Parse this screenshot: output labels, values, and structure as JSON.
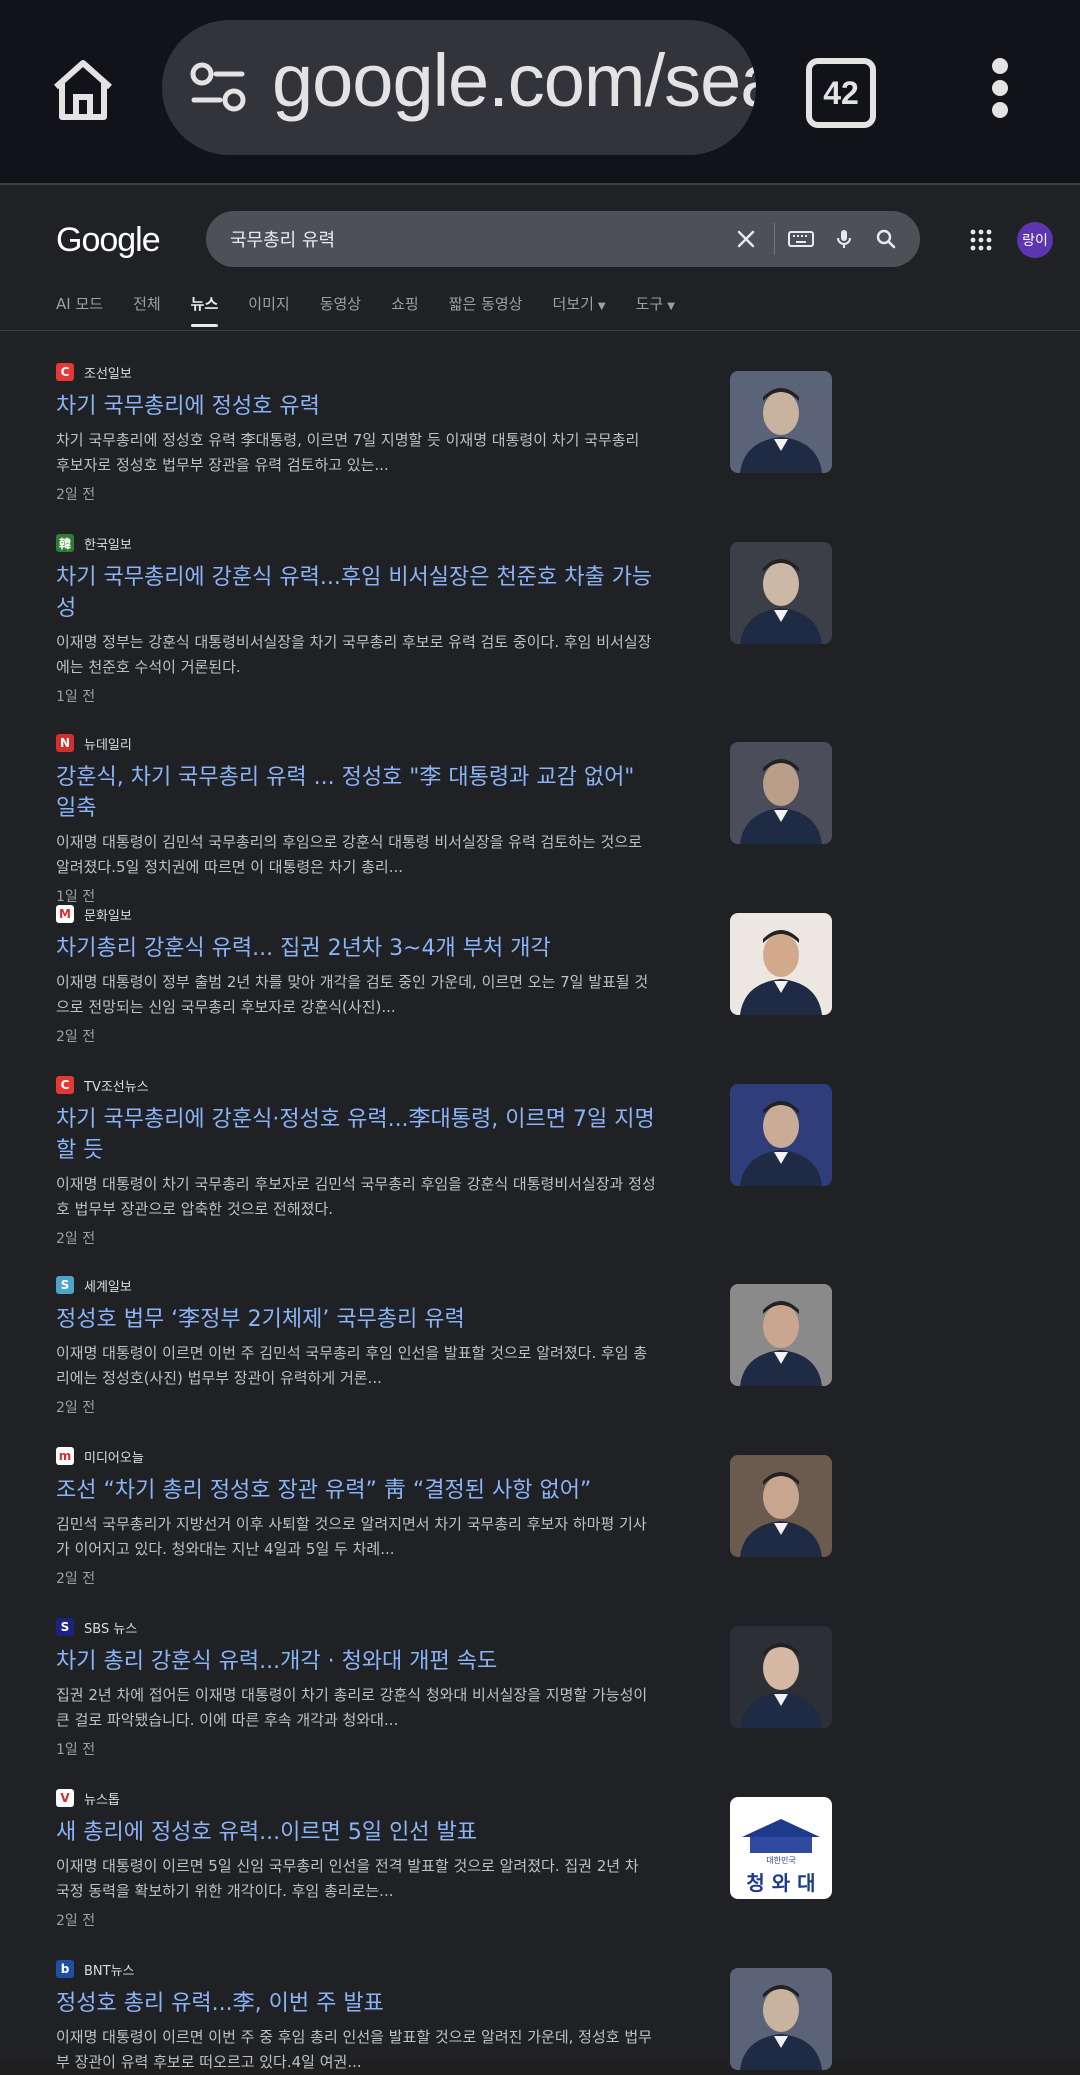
{
  "browser": {
    "url": "google.com/sea",
    "tab_count": "42"
  },
  "google": {
    "logo": "Google",
    "query": "국무총리 유력",
    "avatar": "랑이",
    "nav": [
      {
        "label": "AI 모드"
      },
      {
        "label": "전체"
      },
      {
        "label": "뉴스"
      },
      {
        "label": "이미지"
      },
      {
        "label": "동영상"
      },
      {
        "label": "쇼핑"
      },
      {
        "label": "짧은 동영상"
      },
      {
        "label": "더보기"
      },
      {
        "label": "도구"
      }
    ]
  },
  "results": [
    {
      "source": "조선일보",
      "title": "차기 국무총리에 정성호 유력",
      "snippet": "차기 국무총리에 정성호 유력 李대통령, 이르면 7일 지명할 듯 이재명 대통령이 차기 국무총리 후보자로 정성호 법무부 장관을 유력 검토하고 있는...",
      "time": "2일 전",
      "fav_color": "#e53935",
      "fav_text": "C"
    },
    {
      "source": "한국일보",
      "title": "차기 국무총리에 강훈식 유력...후임 비서실장은 천준호 차출 가능성",
      "snippet": "이재명 정부는 강훈식 대통령비서실장을 차기 국무총리 후보로 유력 검토 중이다. 후임 비서실장에는 천준호 수석이 거론된다.",
      "time": "1일 전",
      "fav_color": "#2e7d32",
      "fav_text": "韓"
    },
    {
      "source": "뉴데일리",
      "title": "강훈식, 차기 국무총리 유력 ... 정성호 \"李 대통령과 교감 없어\" 일축",
      "snippet": "이재명 대통령이 김민석 국무총리의 후임으로 강훈식 대통령 비서실장을 유력 검토하는 것으로 알려졌다.5일 정치권에 따르면 이 대통령은 차기 총리...",
      "time": "1일 전",
      "fav_color": "#d32f2f",
      "fav_text": "N"
    },
    {
      "source": "문화일보",
      "title": "차기총리 강훈식 유력... 집권 2년차 3~4개 부처 개각",
      "snippet": "이재명 대통령이 정부 출범 2년 차를 맞아 개각을 검토 중인 가운데, 이르면 오는 7일 발표될 것으로 전망되는 신임 국무총리 후보자로 강훈식(사진)...",
      "time": "2일 전",
      "fav_color": "#ffffff",
      "fav_text": "M"
    },
    {
      "source": "TV조선뉴스",
      "title": "차기 국무총리에 강훈식·정성호 유력...李대통령, 이르면 7일 지명할 듯",
      "snippet": "이재명 대통령이 차기 국무총리 후보자로 김민석 국무총리 후임을 강훈식 대통령비서실장과 정성호 법무부 장관으로 압축한 것으로 전해졌다.",
      "time": "2일 전",
      "fav_color": "#e53935",
      "fav_text": "C"
    },
    {
      "source": "세계일보",
      "title": "정성호 법무 ‘李정부 2기체제’ 국무총리 유력",
      "snippet": "이재명 대통령이 이르면 이번 주 김민석 국무총리 후임 인선을 발표할 것으로 알려졌다. 후임 총리에는 정성호(사진) 법무부 장관이 유력하게 거론...",
      "time": "2일 전",
      "fav_color": "#4fa3c7",
      "fav_text": "S"
    },
    {
      "source": "미디어오늘",
      "title": "조선 “차기 총리 정성호 장관 유력” 靑 “결정된 사항 없어”",
      "snippet": "김민석 국무총리가 지방선거 이후 사퇴할 것으로 알려지면서 차기 국무총리 후보자 하마평 기사가 이어지고 있다. 청와대는 지난 4일과 5일 두 차례...",
      "time": "2일 전",
      "fav_color": "#ffffff",
      "fav_text": "m"
    },
    {
      "source": "SBS 뉴스",
      "title": "차기 총리 강훈식 유력...개각 · 청와대 개편 속도",
      "snippet": "집권 2년 차에 접어든 이재명 대통령이 차기 총리로 강훈식 청와대 비서실장을 지명할 가능성이 큰 걸로 파악됐습니다. 이에 따른 후속 개각과 청와대...",
      "time": "1일 전",
      "fav_color": "#1a237e",
      "fav_text": "S"
    },
    {
      "source": "뉴스톱",
      "title": "새 총리에 정성호 유력...이르면 5일 인선 발표",
      "snippet": "이재명 대통령이 이르면 5일 신임 국무총리 인선을 전격 발표할 것으로 알려졌다. 집권 2년 차 국정 동력을 확보하기 위한 개각이다. 후임 총리로는...",
      "time": "2일 전",
      "fav_color": "#ffffff",
      "fav_text": "V"
    },
    {
      "source": "BNT뉴스",
      "title": "정성호 총리 유력...李, 이번 주 발표",
      "snippet": "이재명 대통령이 이르면 이번 주 중 후임 총리 인선을 발표할 것으로 알려진 가운데, 정성호 법무부 장관이 유력 후보로 떠오르고 있다.4일 여권...",
      "time": "",
      "fav_color": "#1e4fa1",
      "fav_text": "b"
    }
  ],
  "thumbnail_label": "청 와 대",
  "thumbnail_sublabel": "대한민국"
}
